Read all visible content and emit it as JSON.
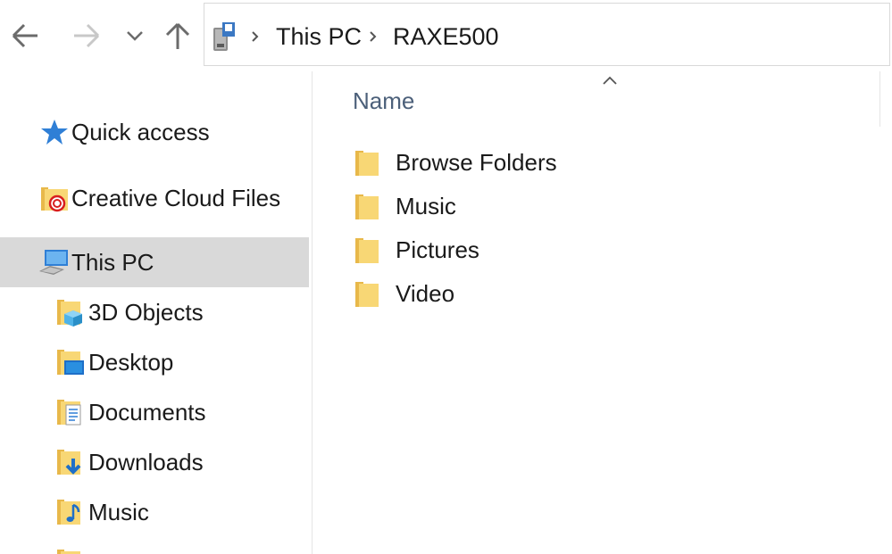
{
  "toolbar": {
    "back_icon": "arrow-left-icon",
    "forward_icon": "arrow-right-icon",
    "recent_icon": "chevron-down-icon",
    "up_icon": "arrow-up-icon"
  },
  "address": {
    "drive_icon": "removable-drive-icon",
    "crumbs": [
      "This PC",
      "RAXE500"
    ]
  },
  "nav": {
    "items": [
      {
        "label": "Quick access",
        "icon": "star-icon"
      },
      {
        "label": "Creative Cloud Files",
        "icon": "creative-cloud-folder-icon"
      },
      {
        "label": "This PC",
        "icon": "computer-icon",
        "selected": true
      },
      {
        "label": "3D Objects",
        "icon": "3d-objects-folder-icon"
      },
      {
        "label": "Desktop",
        "icon": "desktop-folder-icon"
      },
      {
        "label": "Documents",
        "icon": "documents-folder-icon"
      },
      {
        "label": "Downloads",
        "icon": "downloads-folder-icon"
      },
      {
        "label": "Music",
        "icon": "music-folder-icon"
      }
    ]
  },
  "content": {
    "column_header": "Name",
    "sort_icon": "chevron-up-icon",
    "files": [
      {
        "label": "Browse Folders",
        "icon": "folder-icon"
      },
      {
        "label": "Music",
        "icon": "folder-icon"
      },
      {
        "label": "Pictures",
        "icon": "folder-icon"
      },
      {
        "label": "Video",
        "icon": "folder-icon"
      }
    ]
  },
  "colors": {
    "selected_bg": "#d9d9d9",
    "header_text": "#4c607a",
    "folder_yellow": "#f8d775",
    "folder_dark": "#e8b84a"
  }
}
